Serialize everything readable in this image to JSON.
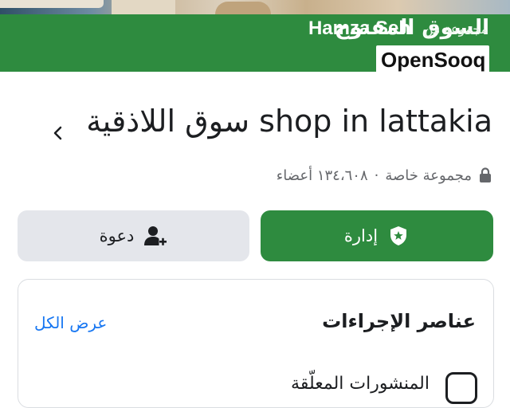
{
  "header": {
    "logo_brand": "OpenSooq",
    "logo_brand_ar": "السوق المفتوح",
    "subtitle": "مجموعة من",
    "owner": "Hamza Seh"
  },
  "group": {
    "name": "سوق اللاذقية shop in lattakia",
    "privacy": "مجموعة خاصة",
    "separator": "·",
    "members": "١٣٤،٦٠٨ أعضاء"
  },
  "actions": {
    "manage_label": "إدارة",
    "invite_label": "دعوة"
  },
  "action_items": {
    "title": "عناصر الإجراءات",
    "see_all": "عرض الكل",
    "first_item": "المنشورات المعلّقة"
  },
  "colors": {
    "brand_green": "#2e8b3f",
    "link_blue": "#1877f2",
    "secondary_button": "#e4e6eb"
  },
  "icons": {
    "chevron": "chevron-left-icon",
    "lock": "lock-icon",
    "manage": "shield-star-icon",
    "invite": "add-person-icon",
    "item": "pending-posts-icon"
  }
}
